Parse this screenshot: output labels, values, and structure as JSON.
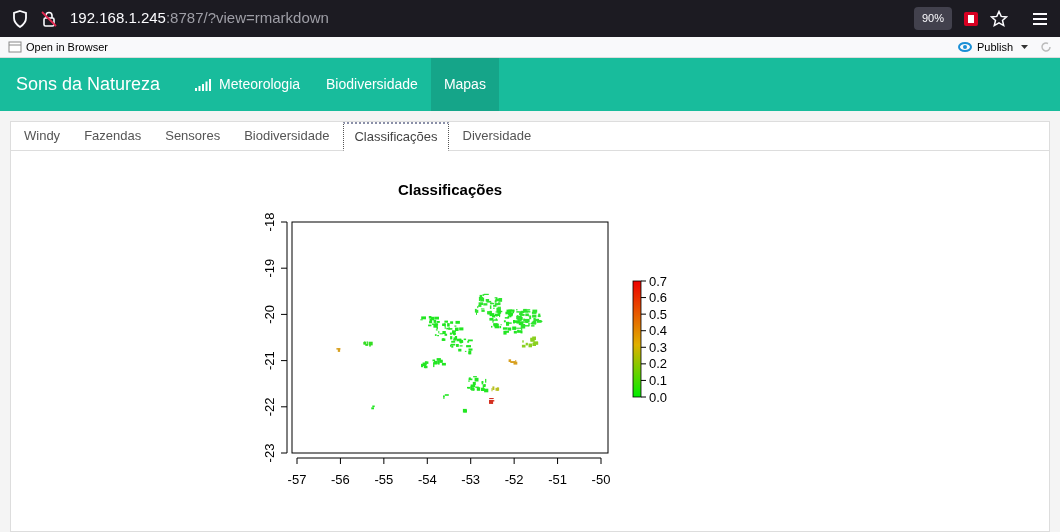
{
  "browser": {
    "url_host": "192.168.1.245",
    "url_rest": ":8787/?view=rmarkdown",
    "zoom": "90%"
  },
  "toolbar": {
    "open_in_browser": "Open in Browser",
    "publish": "Publish"
  },
  "navbar": {
    "brand": "Sons da Natureza",
    "items": [
      {
        "label": "Meteorologia",
        "kind": "signal",
        "selected": false
      },
      {
        "label": "Biodiversidade",
        "kind": "plain",
        "selected": false
      },
      {
        "label": "Mapas",
        "kind": "plain",
        "selected": true
      }
    ]
  },
  "tabs": [
    {
      "label": "Windy",
      "selected": false
    },
    {
      "label": "Fazendas",
      "selected": false
    },
    {
      "label": "Sensores",
      "selected": false
    },
    {
      "label": "Biodiversidade",
      "selected": false
    },
    {
      "label": "Classificações",
      "selected": true
    },
    {
      "label": "Diversidade",
      "selected": false
    }
  ],
  "plot": {
    "title": "Classificações",
    "x_ticks": [
      "-57",
      "-56",
      "-55",
      "-54",
      "-53",
      "-52",
      "-51",
      "-50"
    ],
    "y_ticks": [
      "-18",
      "-19",
      "-20",
      "-21",
      "-22",
      "-23"
    ],
    "legend_ticks": [
      "0.7",
      "0.6",
      "0.5",
      "0.4",
      "0.3",
      "0.2",
      "0.1",
      "0.0"
    ]
  }
}
